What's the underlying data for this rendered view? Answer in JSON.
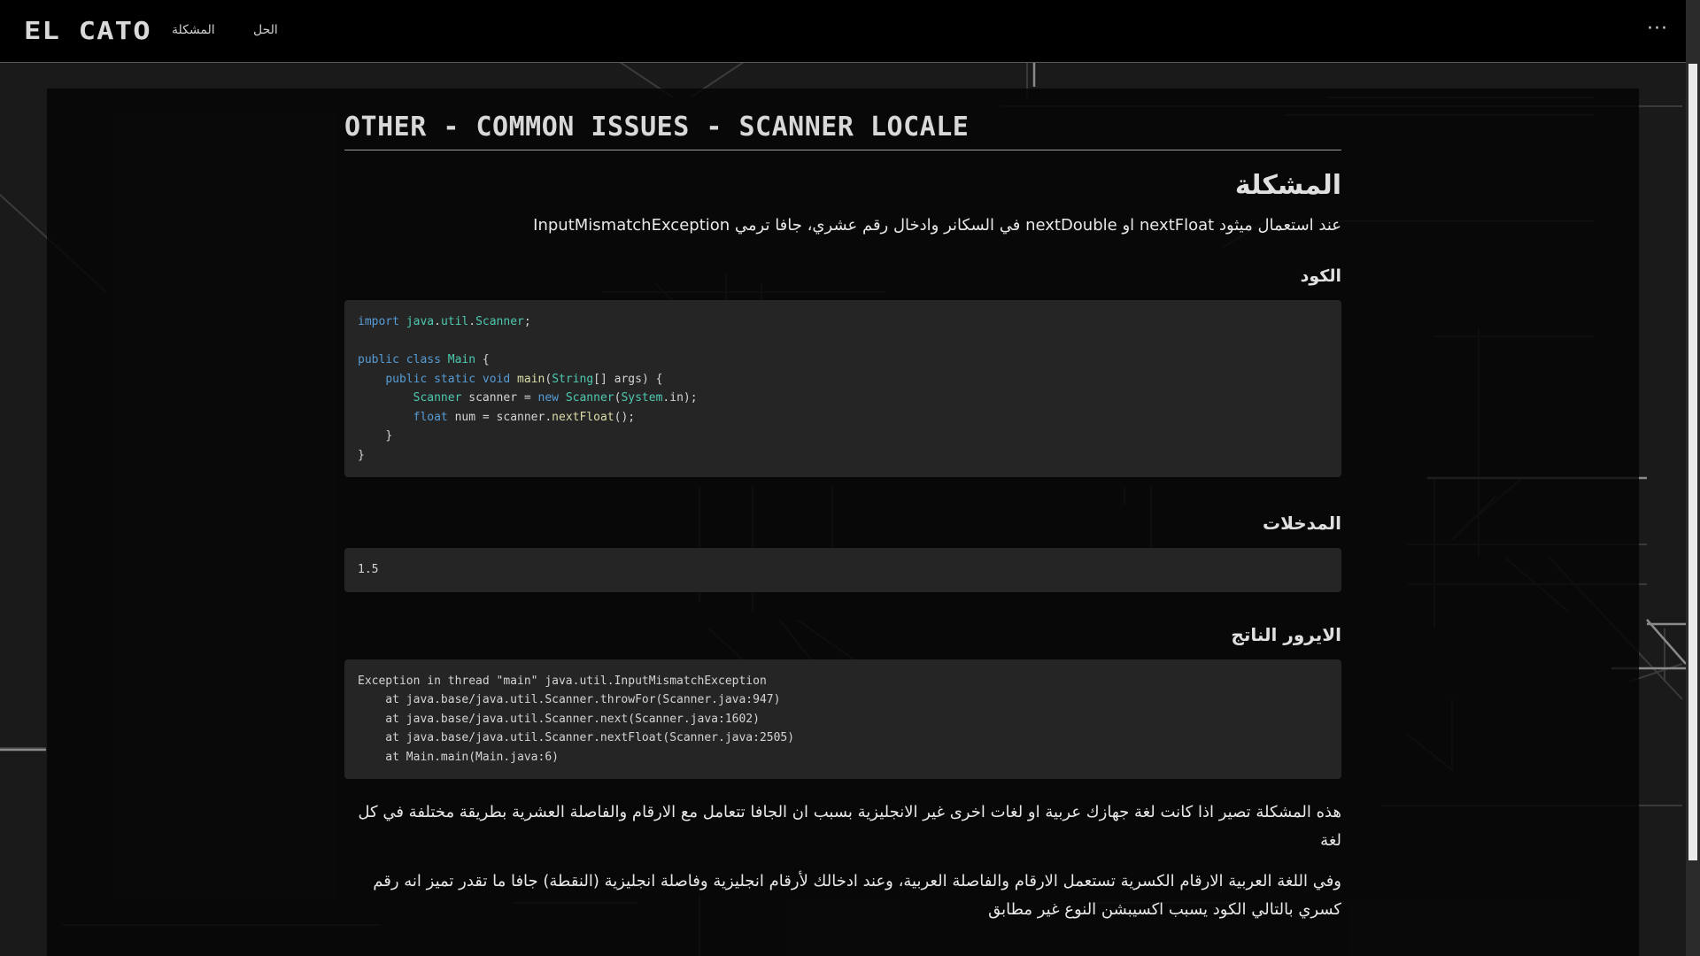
{
  "nav": {
    "logo": "EL CATO",
    "links": [
      "المشكلة",
      "الحل"
    ],
    "more": "···"
  },
  "page": {
    "title": "Other - Common Issues - Scanner Locale",
    "problem_heading": "المشكلة",
    "intro": "عند استعمال ميثود nextFloat او nextDouble في السكانر وادخال رقم عشري، جافا ترمي InputMismatchException",
    "code_heading": "الكود",
    "inputs_heading": "المدخلات",
    "input_value": "1.5",
    "error_heading": "الايرور الناتج",
    "error_lines": [
      "Exception in thread \"main\" java.util.InputMismatchException",
      "    at java.base/java.util.Scanner.throwFor(Scanner.java:947)",
      "    at java.base/java.util.Scanner.next(Scanner.java:1602)",
      "    at java.base/java.util.Scanner.nextFloat(Scanner.java:2505)",
      "    at Main.main(Main.java:6)"
    ],
    "para1": "هذه المشكلة تصير اذا كانت لغة جهازك عربية او لغات اخرى غير الانجليزية بسبب ان الجافا تتعامل مع الارقام والفاصلة العشرية بطريقة مختلفة في كل لغة",
    "para2": "وفي اللغة العربية الارقام الكسرية تستعمل الارقام والفاصلة العربية، وعند ادخالك لأرقام انجليزية وفاصلة انجليزية (النقطة) جافا ما تقدر تميز انه رقم كسري بالتالي الكود يسبب اكسيبشن النوع غير مطابق"
  },
  "code": {
    "l1": {
      "kw": "import",
      "pk1": "java",
      "d1": ".",
      "pk2": "util",
      "d2": ".",
      "ty": "Scanner",
      "end": ";"
    },
    "l3": {
      "kw1": "public",
      "kw2": "class",
      "ty": "Main",
      "end": " {"
    },
    "l4": {
      "kw1": "public",
      "kw2": "static",
      "kw3": "void",
      "fn": "main",
      "p1": "(",
      "ty": "String",
      "p2": "[] args) {"
    },
    "l5": {
      "ty1": "Scanner",
      "p1": " scanner = ",
      "kw": "new",
      "ty2": "Scanner",
      "p2": "(",
      "ty3": "System",
      "p3": ".in);"
    },
    "l6": {
      "kw": "float",
      "p1": " num = scanner.",
      "fn": "nextFloat",
      "p2": "();"
    },
    "l7": "}",
    "l8": "}"
  },
  "colors": {
    "background": "#1a1a1a",
    "panel": "#050505",
    "code_bg": "#252525",
    "keyword": "#569cd6",
    "type": "#4ec9b0",
    "function": "#dcdcaa"
  }
}
